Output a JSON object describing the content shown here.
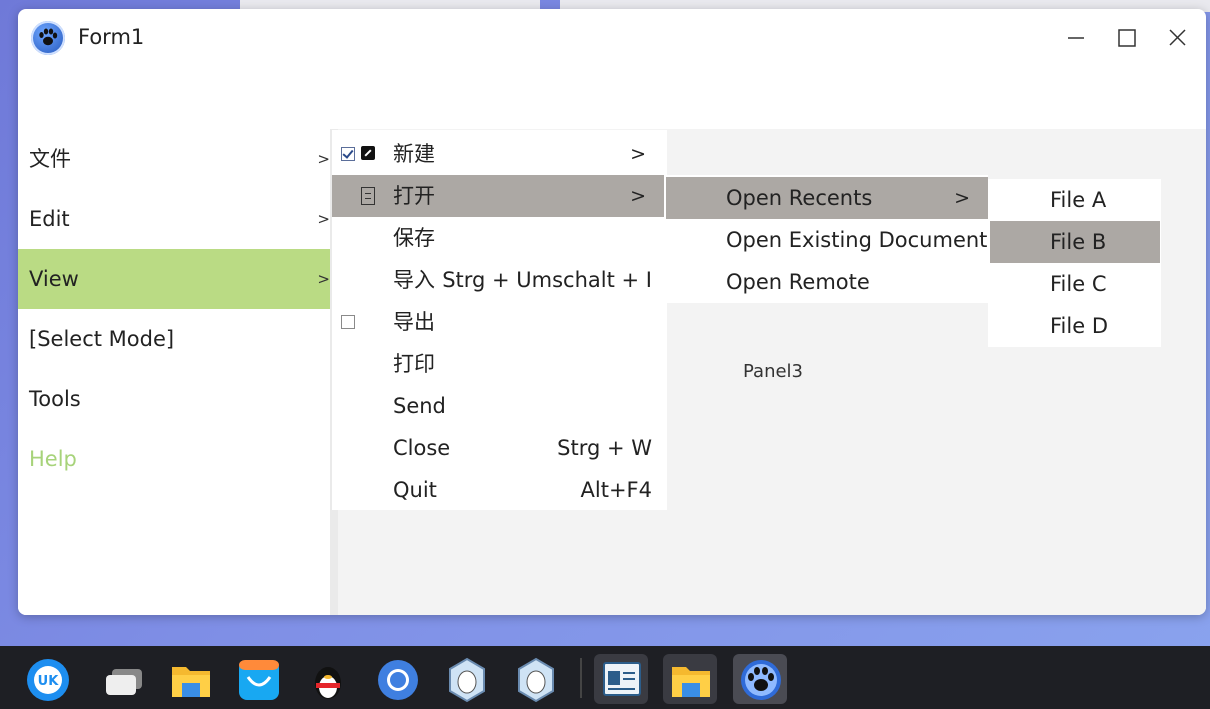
{
  "window": {
    "title": "Form1"
  },
  "sidebar": {
    "items": [
      {
        "label": "文件",
        "arrow": ">"
      },
      {
        "label": "Edit",
        "arrow": ">"
      },
      {
        "label": "View",
        "arrow": ">"
      },
      {
        "label": "[Select Mode]"
      },
      {
        "label": "Tools"
      },
      {
        "label": "Help"
      }
    ]
  },
  "content": {
    "panel_label": "Panel3"
  },
  "menu1": {
    "items": [
      {
        "label": "新建",
        "submenu_arrow": ">",
        "checked": true,
        "icon": "edit-icon"
      },
      {
        "label": "打开",
        "submenu_arrow": ">",
        "icon": "open-icon",
        "highlighted": true
      },
      {
        "label": "保存"
      },
      {
        "label": "导入",
        "shortcut": "Strg + Umschalt + I"
      },
      {
        "label": "导出",
        "checked": false
      },
      {
        "label": "打印"
      },
      {
        "label": "Send"
      },
      {
        "label": "Close",
        "shortcut": "Strg + W"
      },
      {
        "label": "Quit",
        "shortcut": "Alt+F4"
      }
    ]
  },
  "menu2": {
    "items": [
      {
        "label": "Open Recents",
        "submenu_arrow": ">",
        "highlighted": true
      },
      {
        "label": "Open Existing Document"
      },
      {
        "label": "Open Remote"
      }
    ]
  },
  "menu3": {
    "items": [
      {
        "label": "File A"
      },
      {
        "label": "File B",
        "highlighted": true
      },
      {
        "label": "File C"
      },
      {
        "label": "File D"
      }
    ]
  },
  "colors": {
    "active_sidebar": "#badb84",
    "help_text": "#a7d37a",
    "menu_highlight": "#aca8a4",
    "taskbar": "#1e1f24"
  },
  "taskbar": {
    "apps": [
      "start-menu-icon",
      "multitask-view-icon",
      "file-manager-icon",
      "app-store-icon",
      "qq-icon",
      "browser-icon",
      "wolf-app-icon",
      "wolf-app-icon",
      "text-editor-icon",
      "file-manager-icon",
      "lazarus-icon"
    ]
  }
}
